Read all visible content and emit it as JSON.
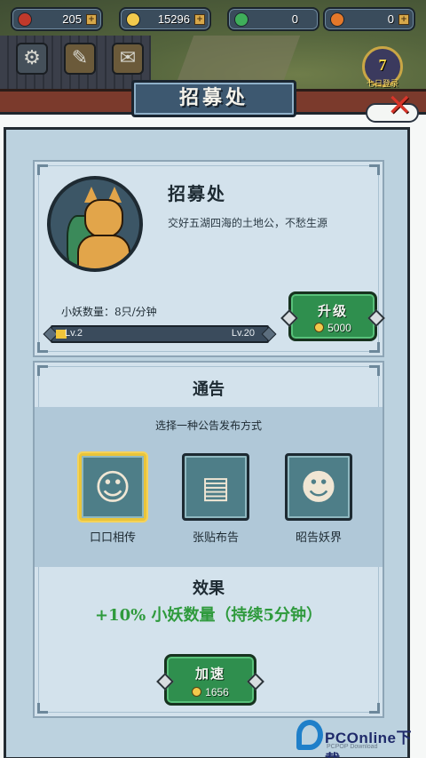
{
  "resources": [
    {
      "icon": "ghost-token-icon",
      "value": "205",
      "color": "#c0392b",
      "has_plus": true
    },
    {
      "icon": "coin-icon",
      "value": "15296",
      "color": "#f2c94c",
      "has_plus": true
    },
    {
      "icon": "jade-icon",
      "value": "0",
      "color": "#3fae5a",
      "has_plus": false
    },
    {
      "icon": "fire-orb-icon",
      "value": "0",
      "color": "#e4782a",
      "has_plus": true
    }
  ],
  "plus_glyph": "+",
  "top_icons": {
    "settings": "gear-icon",
    "notes": "scroll-icon",
    "mail": "envelope-icon"
  },
  "event": {
    "count": "7",
    "label": "七日登录"
  },
  "title": "招募处",
  "recruit": {
    "name": "招募处",
    "description": "交好五湖四海的土地公，不愁生源",
    "rate": "小妖数量：8只/分钟",
    "level_current": "Lv.2",
    "level_max": "Lv.20",
    "level_progress": 0.05,
    "upgrade_label": "升级",
    "upgrade_cost": "5000"
  },
  "announcement": {
    "title": "通告",
    "subtitle": "选择一种公告发布方式",
    "options": [
      {
        "label": "口口相传",
        "icon": "shouting-kid-icon",
        "selected": true
      },
      {
        "label": "张贴布告",
        "icon": "notice-board-icon",
        "selected": false
      },
      {
        "label": "昭告妖界",
        "icon": "sage-scroll-icon",
        "selected": false
      }
    ],
    "effect_title": "效果",
    "effect_text": "+10% 小妖数量（持续5分钟）",
    "speed_label": "加速",
    "speed_cost": "1656"
  },
  "watermark": {
    "brand_a": "PCOnline",
    "brand_b": "下载",
    "tagline": "PCPOP Download"
  },
  "colors": {
    "accent_green": "#2f8f4e",
    "effect_green": "#2e9a3c",
    "panel_blue": "#bcd2df",
    "selected_gold": "#e9c43a"
  }
}
